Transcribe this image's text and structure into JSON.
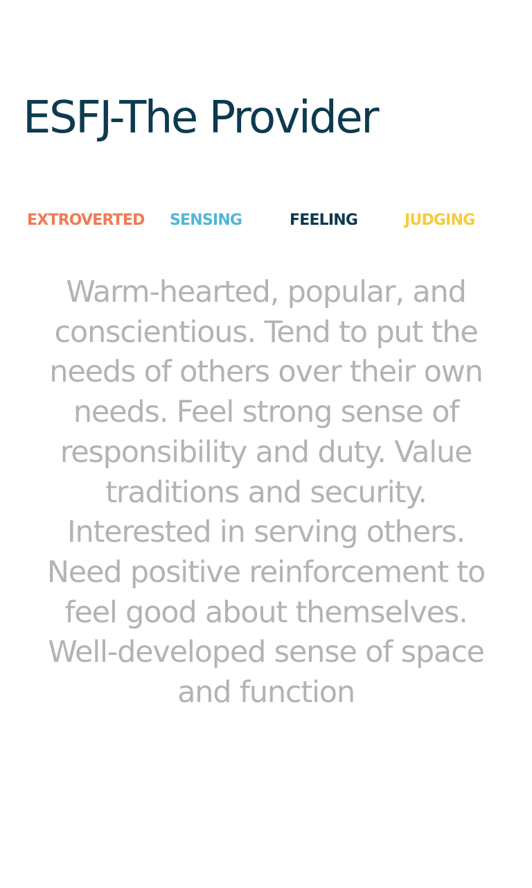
{
  "colors": {
    "title": "#0d3a4e",
    "extroverted": "#f07a53",
    "sensing": "#52b6d4",
    "feeling": "#0d3a4e",
    "judging": "#f5cb3c",
    "description": "#b3b3b3"
  },
  "title": "ESFJ-The Provider",
  "traits": [
    {
      "label": "EXTROVERTED",
      "color": "#f07a53"
    },
    {
      "label": "SENSING",
      "color": "#52b6d4"
    },
    {
      "label": "FEELING",
      "color": "#0d3a4e"
    },
    {
      "label": "JUDGING",
      "color": "#f5cb3c"
    }
  ],
  "description": "Warm-hearted, popular, and conscientious. Tend to put the needs of others over their own needs. Feel strong sense of responsibility and duty. Value traditions and security. Interested in serving others. Need positive reinforcement to feel good about themselves. Well-developed sense of space and function"
}
